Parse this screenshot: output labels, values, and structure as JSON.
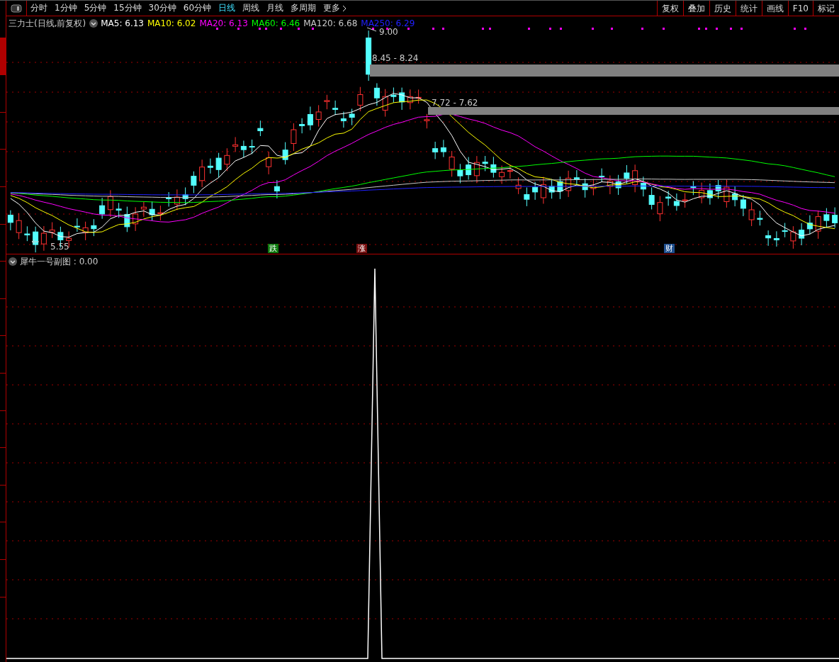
{
  "toolbar": {
    "periods": [
      {
        "label": "分时",
        "selected": false
      },
      {
        "label": "1分钟",
        "selected": false
      },
      {
        "label": "5分钟",
        "selected": false
      },
      {
        "label": "15分钟",
        "selected": false
      },
      {
        "label": "30分钟",
        "selected": false
      },
      {
        "label": "60分钟",
        "selected": false
      },
      {
        "label": "日线",
        "selected": true
      },
      {
        "label": "周线",
        "selected": false
      },
      {
        "label": "月线",
        "selected": false
      },
      {
        "label": "多周期",
        "selected": false
      }
    ],
    "more": "更多",
    "tools": [
      "复权",
      "叠加",
      "历史",
      "统计",
      "画线",
      "F10",
      "标记"
    ]
  },
  "side_tabs": [
    {
      "selected": false
    },
    {
      "selected": true
    },
    {
      "selected": false
    },
    {
      "selected": false
    },
    {
      "selected": false
    },
    {
      "selected": false
    },
    {
      "selected": false
    },
    {
      "selected": false
    },
    {
      "selected": false
    },
    {
      "selected": false
    },
    {
      "selected": false
    },
    {
      "selected": false
    },
    {
      "selected": false
    },
    {
      "selected": false
    },
    {
      "selected": false
    },
    {
      "selected": false
    }
  ],
  "main_chart": {
    "title": "三力士(日线,前复权)",
    "indicators": [
      {
        "label": "MA5: 6.13",
        "color": "#ffffff"
      },
      {
        "label": "MA10: 6.02",
        "color": "#ffff00"
      },
      {
        "label": "MA20: 6.13",
        "color": "#ff00ff"
      },
      {
        "label": "MA60: 6.46",
        "color": "#00ff00"
      },
      {
        "label": "MA120: 6.68",
        "color": "#c8c8c8"
      },
      {
        "label": "MA250: 6.29",
        "color": "#2020ff"
      }
    ],
    "annotations": [
      "9.00",
      "8.45 - 8.24",
      "7.72 - 7.62",
      "5.55"
    ],
    "events": [
      {
        "label": "跌",
        "color": "#0f7a0f"
      },
      {
        "label": "涨",
        "color": "#7a1010"
      },
      {
        "label": "财",
        "color": "#1f4f8f"
      }
    ]
  },
  "sub_chart": {
    "title": "犀牛一号副图 : 0.00"
  }
}
